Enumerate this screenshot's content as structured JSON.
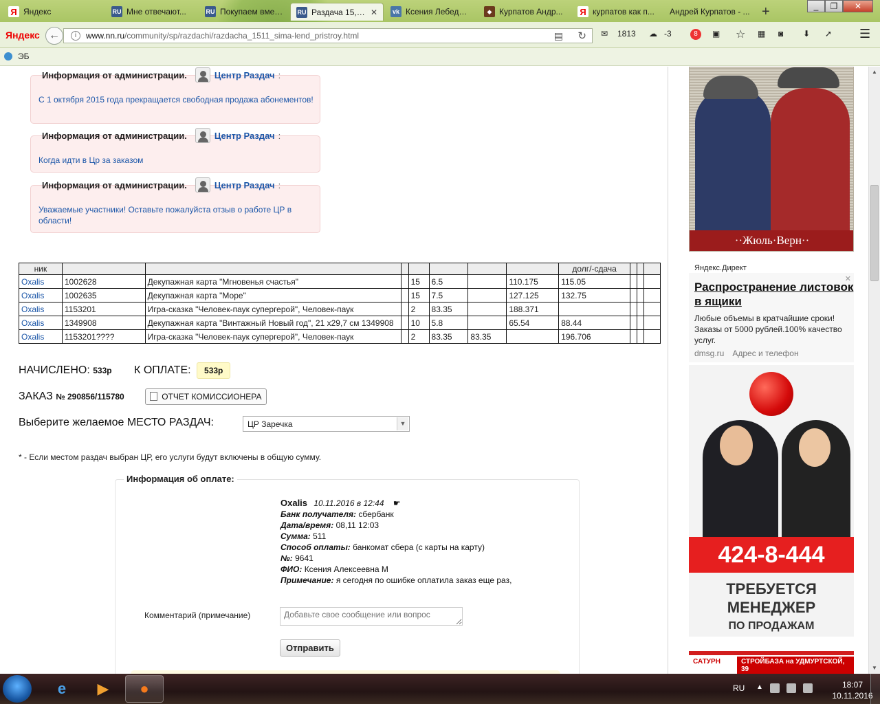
{
  "browser": {
    "tabs": [
      {
        "label": "Яндекс",
        "icon": "yandex-icon"
      },
      {
        "label": "Мне отвечают...",
        "icon": "ru-site-icon"
      },
      {
        "label": "Покупаем вмес...",
        "icon": "ru-site-icon"
      },
      {
        "label": "Раздача 15,1...",
        "icon": "ru-site-icon",
        "active": true
      },
      {
        "label": "Ксения Лебедева",
        "icon": "vk-icon"
      },
      {
        "label": "Курпатов Андр...",
        "icon": "kurpatov-icon"
      },
      {
        "label": "курпатов как п...",
        "icon": "yandex-icon"
      },
      {
        "label": "Андрей Курпатов - ...",
        "icon": ""
      }
    ],
    "brand": "Яндекс",
    "url_host": "www.nn.ru",
    "url_path": "/community/sp/razdachi/razdacha_1511_sima-lend_pristroy.html",
    "mail_count": "1813",
    "weather": "-3",
    "badge_count": "8",
    "bookmark": "ЭБ"
  },
  "notices": [
    {
      "heading": "Информация от администрации.",
      "author": "Центр Раздач",
      "colon": ":",
      "text": "С 1 октября 2015 года прекращается свободная продажа абонементов!"
    },
    {
      "heading": "Информация от администрации.",
      "author": "Центр Раздач",
      "colon": ":",
      "text": "Когда идти в Цр за заказом"
    },
    {
      "heading": "Информация от администрации.",
      "author": "Центр Раздач",
      "colon": ":",
      "text": "Уважаемые участники! Оставьте пожалуйста отзыв о работе ЦР в области!"
    }
  ],
  "table": {
    "headers": [
      "ник",
      "",
      "",
      "",
      "",
      "",
      "",
      "долг/-сдача",
      "",
      "",
      ""
    ],
    "rows": [
      [
        "Oxalis",
        "1002628",
        "Декупажная карта \"Мгновенья счастья\"",
        "",
        "15",
        "6.5",
        "",
        "110.175",
        "115.05",
        "",
        "",
        ""
      ],
      [
        "Oxalis",
        "1002635",
        "Декупажная карта \"Море\"",
        "",
        "15",
        "7.5",
        "",
        "127.125",
        "132.75",
        "",
        "",
        ""
      ],
      [
        "Oxalis",
        "1153201",
        "Игра-сказка \"Человек-паук супергерой\", Человек-паук",
        "",
        "2",
        "83.35",
        "",
        "188.371",
        "",
        "",
        "",
        ""
      ],
      [
        "Oxalis",
        "1349908",
        "Декупажная карта \"Винтажный Новый год\", 21 х29,7 см 1349908",
        "",
        "10",
        "5.8",
        "",
        "65.54",
        "88.44",
        "",
        "",
        ""
      ],
      [
        "Oxalis",
        "1153201????",
        "Игра-сказка \"Человек-паук супергерой\", Человек-паук",
        "",
        "2",
        "83.35",
        "83.35",
        "",
        "196.706",
        "",
        "",
        ""
      ]
    ]
  },
  "summary": {
    "accrued_label": "НАЧИСЛЕНО:",
    "accrued_value": "533р",
    "topay_label": "К ОПЛАТЕ:",
    "topay_value": "533р",
    "order_label": "ЗАКАЗ",
    "order_value": "№ 290856/115780",
    "report_button": "ОТЧЕТ КОМИССИОНЕРА",
    "place_label": "Выберите желаемое МЕСТО РАЗДАЧ:",
    "place_value": "ЦР Заречка",
    "footnote": "* - Если местом раздач выбран ЦР, его услуги будут включены в общую сумму."
  },
  "payment": {
    "legend": "Информация об оплате:",
    "author": "Oxalis",
    "datetime": "10.11.2016 в 12:44",
    "fields": [
      {
        "label": "Банк получателя:",
        "value": "сбербанк"
      },
      {
        "label": "Дата/время:",
        "value": "08,11 12:03"
      },
      {
        "label": "Сумма:",
        "value": "511"
      },
      {
        "label": "Способ оплаты:",
        "value": "банкомат сбера (с карты на карту)"
      },
      {
        "label": "№:",
        "value": "9641"
      },
      {
        "label": "ФИО:",
        "value": "Ксения Алексеевна М"
      },
      {
        "label": "Примечание:",
        "value": "я сегодня по ошибке оплатила заказ еще раз,"
      }
    ],
    "comment_label": "Комментарий (примечание)",
    "comment_placeholder": "Добавьте свое сообщение или вопрос",
    "send_button": "Отправить"
  },
  "ads": {
    "book_caption": "··Жюль·Верн··",
    "direct_label": "Яндекс.Директ",
    "direct_title": "Распространение листовок в ящики",
    "direct_text": "Любые объемы в кратчайшие сроки! Заказы от 5000 рублей.100% качество услуг.",
    "direct_domain": "dmsg.ru",
    "direct_link": "Адрес и телефон",
    "job_phone": "424-8-444",
    "job_line1": "ТРЕБУЕТСЯ",
    "job_line2": "МЕНЕДЖЕР",
    "job_line3": "ПО ПРОДАЖАМ",
    "saturn_brand": "САТУРН",
    "saturn_text": "СТРОЙБАЗА на УДМУРТСКОЙ, 39"
  },
  "taskbar": {
    "lang": "RU",
    "time": "18:07",
    "date": "10.11.2016"
  }
}
